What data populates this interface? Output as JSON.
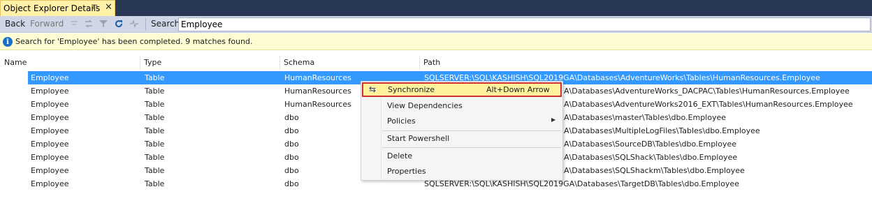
{
  "tab": {
    "title": "Object Explorer Details",
    "pin_glyph": "⊓",
    "close_glyph": "✕"
  },
  "toolbar": {
    "back_label": "Back",
    "forward_label": "Forward",
    "search_label": "Search",
    "search_value": "Employee"
  },
  "info": {
    "icon_glyph": "i",
    "message": "Search for 'Employee' has been completed. 9 matches found."
  },
  "columns": {
    "name": "Name",
    "type": "Type",
    "schema": "Schema",
    "path": "Path"
  },
  "rows": [
    {
      "name": "Employee",
      "type": "Table",
      "schema": "HumanResources",
      "path": "SQLSERVER:\\SQL\\KASHISH\\SQL2019GA\\Databases\\AdventureWorks\\Tables\\HumanResources.Employee"
    },
    {
      "name": "Employee",
      "type": "Table",
      "schema": "HumanResources",
      "path": "A\\Databases\\AdventureWorks_DACPAC\\Tables\\HumanResources.Employee"
    },
    {
      "name": "Employee",
      "type": "Table",
      "schema": "HumanResources",
      "path": "A\\Databases\\AdventureWorks2016_EXT\\Tables\\HumanResources.Employee"
    },
    {
      "name": "Employee",
      "type": "Table",
      "schema": "dbo",
      "path": "A\\Databases\\master\\Tables\\dbo.Employee"
    },
    {
      "name": "Employee",
      "type": "Table",
      "schema": "dbo",
      "path": "A\\Databases\\MultipleLogFiles\\Tables\\dbo.Employee"
    },
    {
      "name": "Employee",
      "type": "Table",
      "schema": "dbo",
      "path": "A\\Databases\\SourceDB\\Tables\\dbo.Employee"
    },
    {
      "name": "Employee",
      "type": "Table",
      "schema": "dbo",
      "path": "A\\Databases\\SQLShack\\Tables\\dbo.Employee"
    },
    {
      "name": "Employee",
      "type": "Table",
      "schema": "dbo",
      "path": "A\\Databases\\SQLShackm\\Tables\\dbo.Employee"
    },
    {
      "name": "Employee",
      "type": "Table",
      "schema": "dbo",
      "path": "SQLSERVER:\\SQL\\KASHISH\\SQL2019GA\\Databases\\TargetDB\\Tables\\dbo.Employee"
    }
  ],
  "context_menu": {
    "synchronize": {
      "label": "Synchronize",
      "shortcut": "Alt+Down Arrow",
      "icon_glyph": "⇆"
    },
    "view_dependencies": "View Dependencies",
    "policies": {
      "label": "Policies",
      "arrow_glyph": "▶"
    },
    "start_powershell": "Start Powershell",
    "delete": "Delete",
    "properties": "Properties"
  },
  "colors": {
    "selection": "#3399ff",
    "menu_highlight": "#fff29d",
    "menu_highlight_border": "#d0302f",
    "tab_active": "#fff1a8",
    "titlebar": "#293955"
  }
}
